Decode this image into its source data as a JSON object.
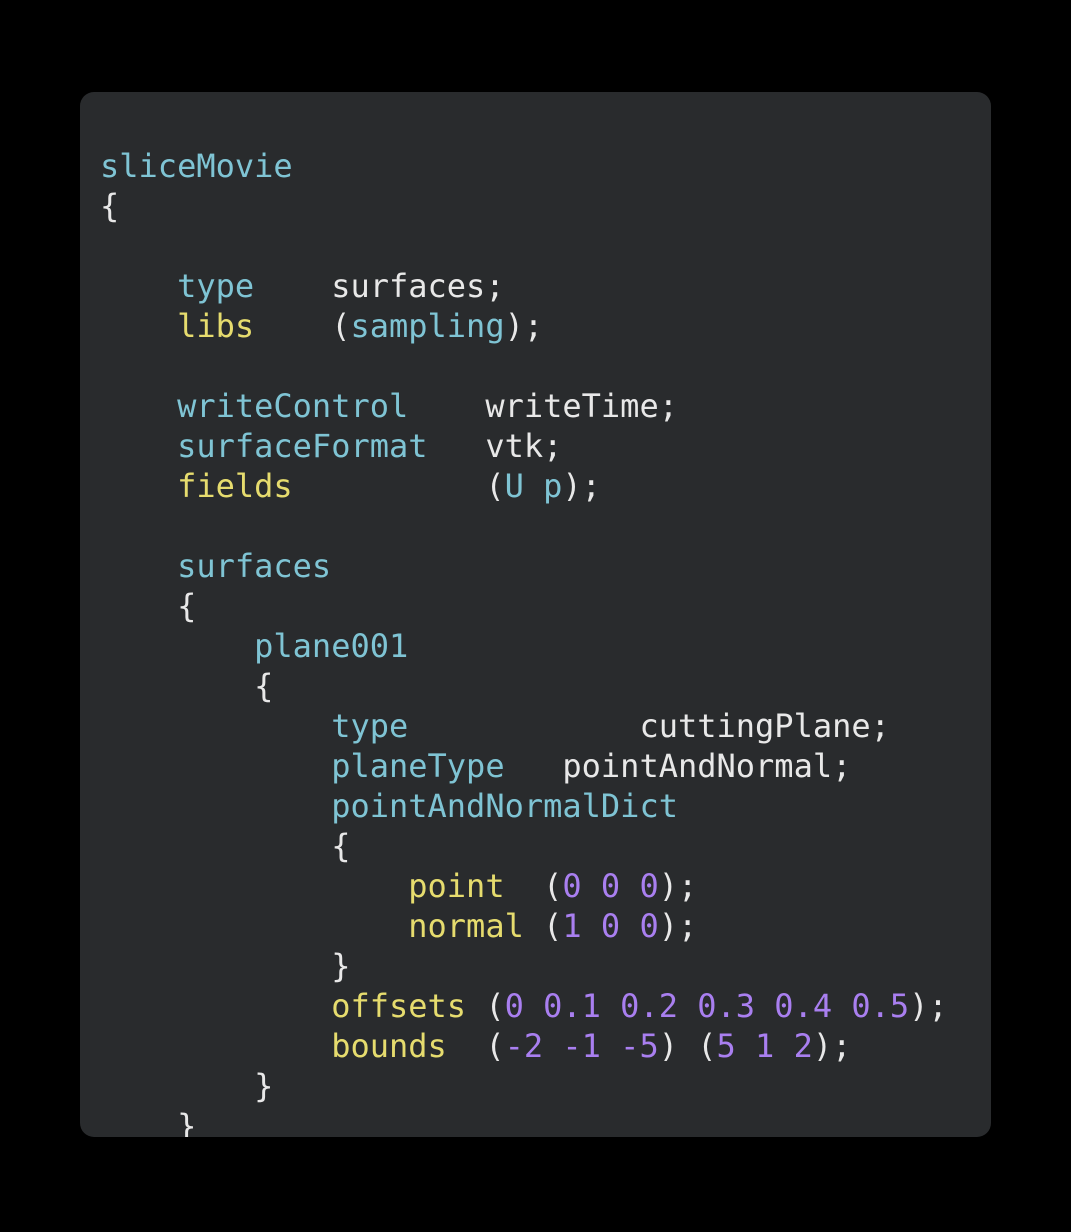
{
  "card": {
    "background_color": "#292b2d",
    "page_background_color": "#000000",
    "corner_radius": "14px"
  },
  "theme": {
    "key_color": "#7fc4d4",
    "key_alt_color": "#e6dc6e",
    "value_color": "#e8e8e8",
    "number_color": "#a97ff0",
    "punctuation_color": "#e8e8e8"
  },
  "code": {
    "language": "OpenFOAM dictionary",
    "title": "sliceMovie",
    "indent_unit": 4,
    "lines": [
      {
        "n": 1,
        "indent": 0,
        "tokens": [
          {
            "t": "sliceMovie",
            "c": "dict"
          }
        ]
      },
      {
        "n": 2,
        "indent": 0,
        "tokens": [
          {
            "t": "{",
            "c": "punct"
          }
        ]
      },
      {
        "n": 3,
        "indent": 0,
        "tokens": []
      },
      {
        "n": 4,
        "indent": 4,
        "tokens": [
          {
            "t": "type",
            "c": "key"
          },
          {
            "t": "    ",
            "c": "plain"
          },
          {
            "t": "surfaces;",
            "c": "value"
          }
        ]
      },
      {
        "n": 5,
        "indent": 4,
        "tokens": [
          {
            "t": "libs",
            "c": "keyalt"
          },
          {
            "t": "    ",
            "c": "plain"
          },
          {
            "t": "(",
            "c": "punct"
          },
          {
            "t": "sampling",
            "c": "key"
          },
          {
            "t": ");",
            "c": "punct"
          }
        ]
      },
      {
        "n": 6,
        "indent": 0,
        "tokens": []
      },
      {
        "n": 7,
        "indent": 4,
        "tokens": [
          {
            "t": "writeControl",
            "c": "key"
          },
          {
            "t": "    ",
            "c": "plain"
          },
          {
            "t": "writeTime;",
            "c": "value"
          }
        ]
      },
      {
        "n": 8,
        "indent": 4,
        "tokens": [
          {
            "t": "surfaceFormat",
            "c": "key"
          },
          {
            "t": "   ",
            "c": "plain"
          },
          {
            "t": "vtk;",
            "c": "value"
          }
        ]
      },
      {
        "n": 9,
        "indent": 4,
        "tokens": [
          {
            "t": "fields",
            "c": "keyalt"
          },
          {
            "t": "          ",
            "c": "plain"
          },
          {
            "t": "(",
            "c": "punct"
          },
          {
            "t": "U",
            "c": "key"
          },
          {
            "t": " ",
            "c": "plain"
          },
          {
            "t": "p",
            "c": "key"
          },
          {
            "t": ");",
            "c": "punct"
          }
        ]
      },
      {
        "n": 10,
        "indent": 0,
        "tokens": []
      },
      {
        "n": 11,
        "indent": 4,
        "tokens": [
          {
            "t": "surfaces",
            "c": "dict"
          }
        ]
      },
      {
        "n": 12,
        "indent": 4,
        "tokens": [
          {
            "t": "{",
            "c": "punct"
          }
        ]
      },
      {
        "n": 13,
        "indent": 8,
        "tokens": [
          {
            "t": "plane001",
            "c": "dict"
          }
        ]
      },
      {
        "n": 14,
        "indent": 8,
        "tokens": [
          {
            "t": "{",
            "c": "punct"
          }
        ]
      },
      {
        "n": 15,
        "indent": 12,
        "tokens": [
          {
            "t": "type",
            "c": "key"
          },
          {
            "t": "            ",
            "c": "plain"
          },
          {
            "t": "cuttingPlane;",
            "c": "value"
          }
        ]
      },
      {
        "n": 16,
        "indent": 12,
        "tokens": [
          {
            "t": "planeType",
            "c": "key"
          },
          {
            "t": "   ",
            "c": "plain"
          },
          {
            "t": "pointAndNormal;",
            "c": "value"
          }
        ]
      },
      {
        "n": 17,
        "indent": 12,
        "tokens": [
          {
            "t": "pointAndNormalDict",
            "c": "dict"
          }
        ]
      },
      {
        "n": 18,
        "indent": 12,
        "tokens": [
          {
            "t": "{",
            "c": "punct"
          }
        ]
      },
      {
        "n": 19,
        "indent": 16,
        "tokens": [
          {
            "t": "point",
            "c": "keyalt"
          },
          {
            "t": "  ",
            "c": "plain"
          },
          {
            "t": "(",
            "c": "punct"
          },
          {
            "t": "0",
            "c": "num"
          },
          {
            "t": " ",
            "c": "plain"
          },
          {
            "t": "0",
            "c": "num"
          },
          {
            "t": " ",
            "c": "plain"
          },
          {
            "t": "0",
            "c": "num"
          },
          {
            "t": ");",
            "c": "punct"
          }
        ]
      },
      {
        "n": 20,
        "indent": 16,
        "tokens": [
          {
            "t": "normal",
            "c": "keyalt"
          },
          {
            "t": " ",
            "c": "plain"
          },
          {
            "t": "(",
            "c": "punct"
          },
          {
            "t": "1",
            "c": "num"
          },
          {
            "t": " ",
            "c": "plain"
          },
          {
            "t": "0",
            "c": "num"
          },
          {
            "t": " ",
            "c": "plain"
          },
          {
            "t": "0",
            "c": "num"
          },
          {
            "t": ");",
            "c": "punct"
          }
        ]
      },
      {
        "n": 21,
        "indent": 12,
        "tokens": [
          {
            "t": "}",
            "c": "punct"
          }
        ]
      },
      {
        "n": 22,
        "indent": 12,
        "tokens": [
          {
            "t": "offsets",
            "c": "keyalt"
          },
          {
            "t": " ",
            "c": "plain"
          },
          {
            "t": "(",
            "c": "punct"
          },
          {
            "t": "0",
            "c": "num"
          },
          {
            "t": " ",
            "c": "plain"
          },
          {
            "t": "0.1",
            "c": "num"
          },
          {
            "t": " ",
            "c": "plain"
          },
          {
            "t": "0.2",
            "c": "num"
          },
          {
            "t": " ",
            "c": "plain"
          },
          {
            "t": "0.3",
            "c": "num"
          },
          {
            "t": " ",
            "c": "plain"
          },
          {
            "t": "0.4",
            "c": "num"
          },
          {
            "t": " ",
            "c": "plain"
          },
          {
            "t": "0.5",
            "c": "num"
          },
          {
            "t": ");",
            "c": "punct"
          }
        ]
      },
      {
        "n": 23,
        "indent": 12,
        "tokens": [
          {
            "t": "bounds",
            "c": "keyalt"
          },
          {
            "t": "  ",
            "c": "plain"
          },
          {
            "t": "(",
            "c": "punct"
          },
          {
            "t": "-2",
            "c": "num"
          },
          {
            "t": " ",
            "c": "plain"
          },
          {
            "t": "-1",
            "c": "num"
          },
          {
            "t": " ",
            "c": "plain"
          },
          {
            "t": "-5",
            "c": "num"
          },
          {
            "t": ")",
            "c": "punct"
          },
          {
            "t": " ",
            "c": "plain"
          },
          {
            "t": "(",
            "c": "punct"
          },
          {
            "t": "5",
            "c": "num"
          },
          {
            "t": " ",
            "c": "plain"
          },
          {
            "t": "1",
            "c": "num"
          },
          {
            "t": " ",
            "c": "plain"
          },
          {
            "t": "2",
            "c": "num"
          },
          {
            "t": ");",
            "c": "punct"
          }
        ]
      },
      {
        "n": 24,
        "indent": 8,
        "tokens": [
          {
            "t": "}",
            "c": "punct"
          }
        ]
      },
      {
        "n": 25,
        "indent": 4,
        "tokens": [
          {
            "t": "}",
            "c": "punct"
          }
        ]
      },
      {
        "n": 26,
        "indent": 0,
        "tokens": [
          {
            "t": "}",
            "c": "punct"
          }
        ]
      }
    ]
  }
}
